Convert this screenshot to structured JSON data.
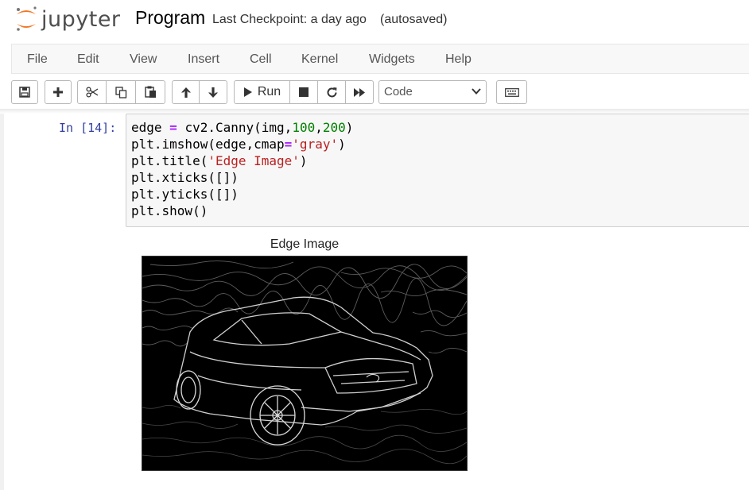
{
  "header": {
    "logo_text": "jupyter",
    "notebook_title": "Program",
    "checkpoint_text": "Last Checkpoint: a day ago",
    "autosave_text": "(autosaved)"
  },
  "menubar": {
    "items": [
      "File",
      "Edit",
      "View",
      "Insert",
      "Cell",
      "Kernel",
      "Widgets",
      "Help"
    ]
  },
  "toolbar": {
    "buttons": [
      "save-icon",
      "plus-icon",
      "cut-icon",
      "copy-icon",
      "paste-icon",
      "arrow-up-icon",
      "arrow-down-icon",
      "run-icon",
      "stop-icon",
      "restart-icon",
      "fast-forward-icon",
      "keyboard-icon"
    ],
    "run_label": "Run",
    "cell_type": "Code"
  },
  "cell": {
    "prompt": "In [14]:",
    "code_lines": [
      "edge = cv2.Canny(img,100,200)",
      "plt.imshow(edge,cmap='gray')",
      "plt.title('Edge Image')",
      "plt.xticks([])",
      "plt.yticks([])",
      "plt.show()"
    ]
  },
  "output": {
    "plot_title": "Edge Image"
  },
  "colors": {
    "prompt": "#303f9f",
    "keyword_op": "#aa22ff",
    "number": "#008000",
    "string": "#ba2121",
    "logo_orange": "#f37726"
  }
}
